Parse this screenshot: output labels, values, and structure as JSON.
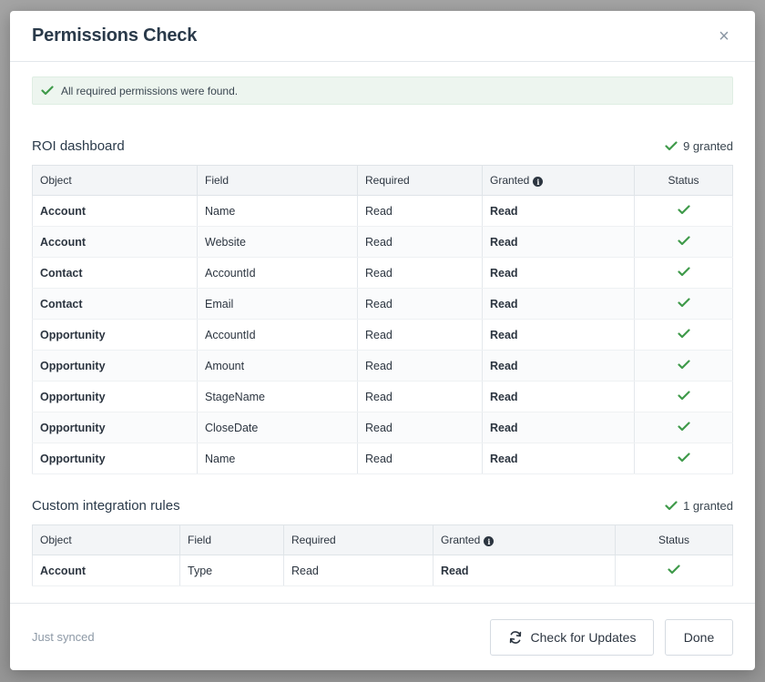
{
  "dialog": {
    "title": "Permissions Check",
    "close_symbol": "×",
    "alert_text": "All required permissions were found."
  },
  "sections": [
    {
      "title": "ROI dashboard",
      "count_label": "9 granted",
      "columns": [
        "Object",
        "Field",
        "Required",
        "Granted",
        "Status"
      ],
      "rows": [
        {
          "object": "Account",
          "field": "Name",
          "required": "Read",
          "granted": "Read",
          "status": "check-icon"
        },
        {
          "object": "Account",
          "field": "Website",
          "required": "Read",
          "granted": "Read",
          "status": "check-icon"
        },
        {
          "object": "Contact",
          "field": "AccountId",
          "required": "Read",
          "granted": "Read",
          "status": "check-icon"
        },
        {
          "object": "Contact",
          "field": "Email",
          "required": "Read",
          "granted": "Read",
          "status": "check-icon"
        },
        {
          "object": "Opportunity",
          "field": "AccountId",
          "required": "Read",
          "granted": "Read",
          "status": "check-icon"
        },
        {
          "object": "Opportunity",
          "field": "Amount",
          "required": "Read",
          "granted": "Read",
          "status": "check-icon"
        },
        {
          "object": "Opportunity",
          "field": "StageName",
          "required": "Read",
          "granted": "Read",
          "status": "check-icon"
        },
        {
          "object": "Opportunity",
          "field": "CloseDate",
          "required": "Read",
          "granted": "Read",
          "status": "check-icon"
        },
        {
          "object": "Opportunity",
          "field": "Name",
          "required": "Read",
          "granted": "Read",
          "status": "check-icon"
        }
      ]
    },
    {
      "title": "Custom integration rules",
      "count_label": "1 granted",
      "columns": [
        "Object",
        "Field",
        "Required",
        "Granted",
        "Status"
      ],
      "rows": [
        {
          "object": "Account",
          "field": "Type",
          "required": "Read",
          "granted": "Read",
          "status": "check-icon"
        }
      ]
    }
  ],
  "footer": {
    "status_text": "Just synced",
    "check_updates_label": "Check for Updates",
    "done_label": "Done"
  },
  "colors": {
    "success_green": "#3f9a4a",
    "alert_bg": "#edf5ef",
    "table_header_bg": "#f3f5f7"
  }
}
